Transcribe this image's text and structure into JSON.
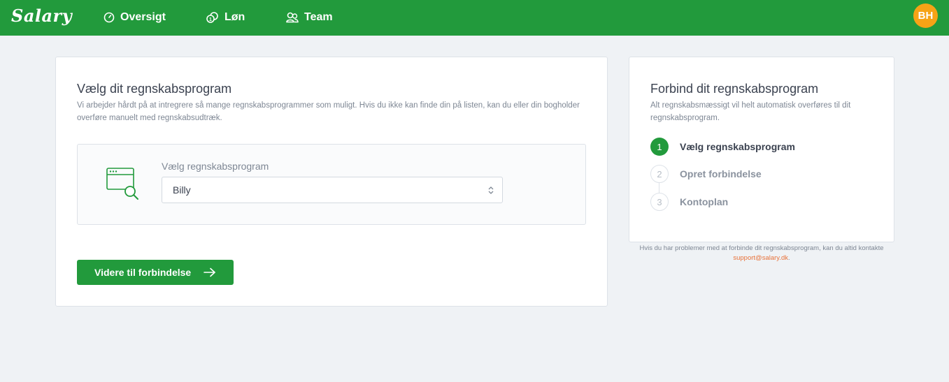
{
  "header": {
    "logo": "Salary",
    "nav": [
      {
        "label": "Oversigt",
        "icon": "gauge-icon"
      },
      {
        "label": "Løn",
        "icon": "coins-icon"
      },
      {
        "label": "Team",
        "icon": "team-icon"
      }
    ],
    "avatar_initials": "BH"
  },
  "main": {
    "title": "Vælg dit regnskabsprogram",
    "description": "Vi arbejder hårdt på at intregrere så mange regnskabsprogrammer som muligt. Hvis du ikke kan finde din på listen, kan du eller din bogholder overføre manuelt med regnskabsudtræk.",
    "picker": {
      "label": "Vælg regnskabsprogram",
      "selected": "Billy"
    },
    "continue_button": "Videre til forbindelse"
  },
  "side": {
    "title": "Forbind dit regnskabsprogram",
    "description": "Alt regnskabsmæssigt vil helt automatisk overføres til dit regnskabsprogram.",
    "steps": [
      {
        "number": "1",
        "label": "Vælg regnskabsprogram",
        "active": true
      },
      {
        "number": "2",
        "label": "Opret forbindelse",
        "active": false
      },
      {
        "number": "3",
        "label": "Kontoplan",
        "active": false
      }
    ],
    "footnote_text": "Hvis du har problemer med at forbinde dit regnskabsprogram, kan du altid kontakte",
    "support_email": "support@salary.dk",
    "footnote_end": "."
  },
  "colors": {
    "brand_green": "#229a3c",
    "avatar_orange": "#f6a316",
    "link_orange": "#e8723a",
    "background": "#eff2f5"
  }
}
